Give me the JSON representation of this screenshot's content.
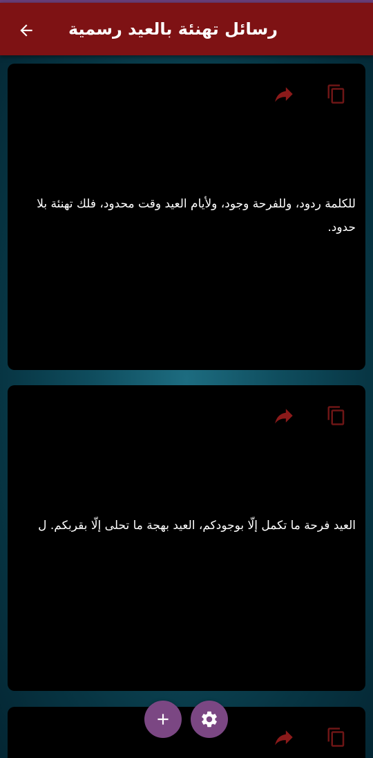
{
  "app_bar": {
    "title": "رسائل تهنئة بالعيد رسمية",
    "back_icon": "arrow-back-icon",
    "background": "#7e1214"
  },
  "cards": [
    {
      "text": "للكلمة ردود، وللفرحة وجود، ولأيام العيد وقت محدود، فلك تهنئة بلا حدود.",
      "actions": [
        "copy-icon",
        "share-icon"
      ]
    },
    {
      "text": "العيد فرحة ما تكمل إلّا بوجودكم، العيد بهجة ما تحلى إلّا بقربكم. ل",
      "actions": [
        "copy-icon",
        "share-icon"
      ]
    },
    {
      "text": "",
      "actions": [
        "copy-icon",
        "share-icon"
      ]
    }
  ],
  "fabs": {
    "add_icon": "plus-icon",
    "settings_icon": "gear-icon",
    "color": "#7b4783"
  },
  "accent_icon_color": "#8b1a1a"
}
